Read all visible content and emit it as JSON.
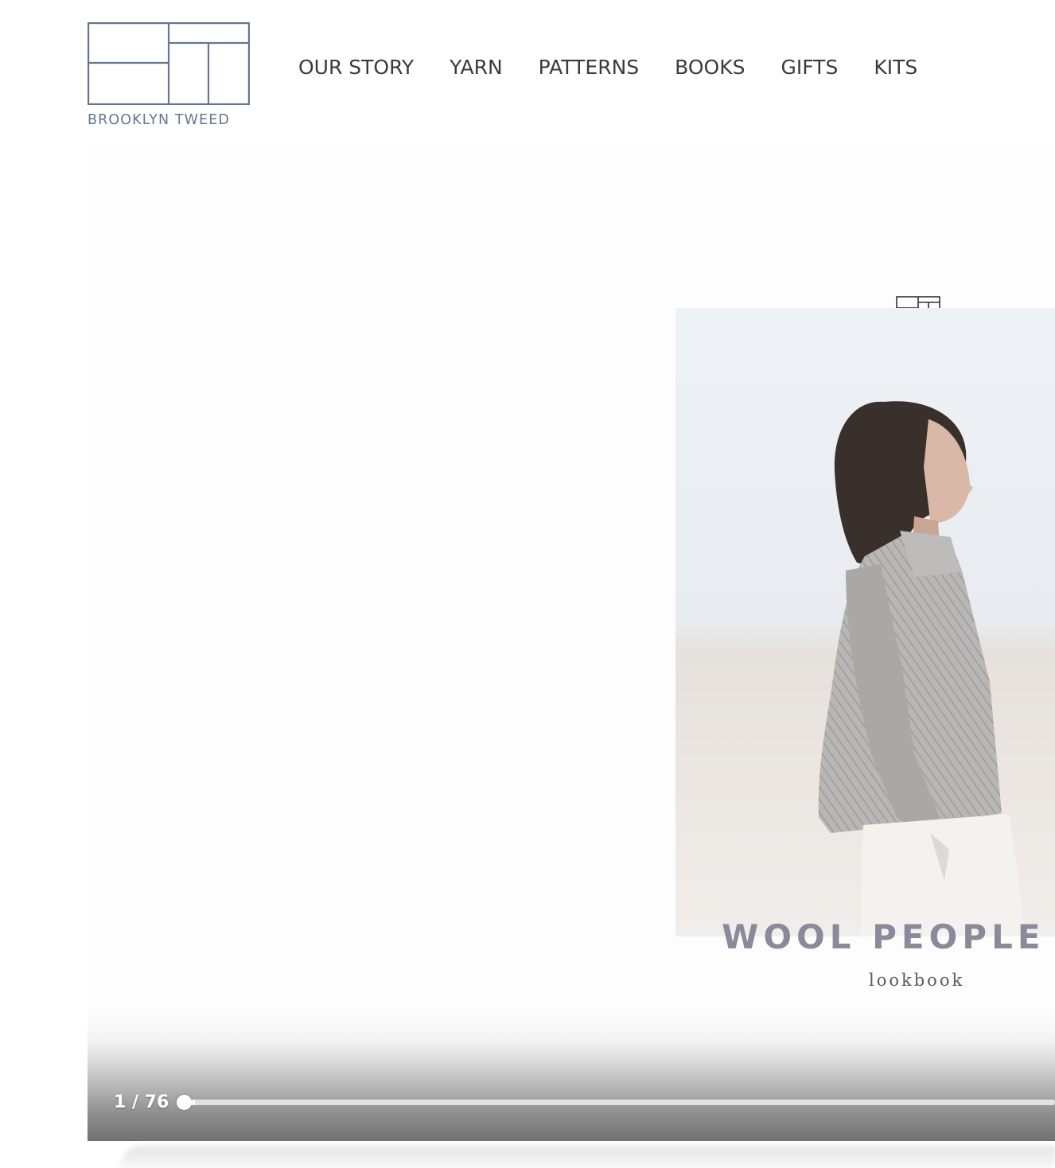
{
  "header": {
    "brand_name": "BROOKLYN TWEED",
    "brand_color": "#66768f",
    "nav": [
      {
        "label": "OUR STORY"
      },
      {
        "label": "YARN"
      },
      {
        "label": "PATTERNS"
      },
      {
        "label": "BOOKS"
      },
      {
        "label": "GIFTS"
      },
      {
        "label": "KITS"
      }
    ]
  },
  "viewer": {
    "cover": {
      "title": "WOOL PEOPLE",
      "subtitle": "lookbook",
      "title_color": "#8b8a9a"
    },
    "page_counter": "1 / 76",
    "current_page": 1,
    "total_pages": 76,
    "progress_fraction": 0.013
  }
}
